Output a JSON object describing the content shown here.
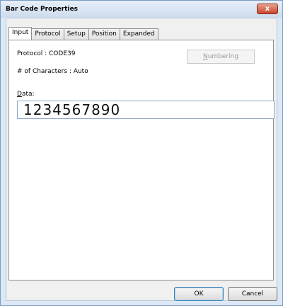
{
  "window": {
    "title": "Bar Code Properties",
    "close_glyph": "x"
  },
  "tabs": [
    {
      "label": "Input"
    },
    {
      "label": "Protocol"
    },
    {
      "label": "Setup"
    },
    {
      "label": "Position"
    },
    {
      "label": "Expanded"
    }
  ],
  "input_tab": {
    "protocol_text": "Protocol : CODE39",
    "chars_text": "# of Characters : Auto",
    "numbering_label": "Numbering",
    "data_label": "Data:",
    "data_value": "1234567890"
  },
  "footer": {
    "ok_label": "OK",
    "cancel_label": "Cancel"
  },
  "colors": {
    "frame": "#dce8f5",
    "close_button": "#c9462c"
  },
  "icons": {
    "close": "close-icon"
  }
}
